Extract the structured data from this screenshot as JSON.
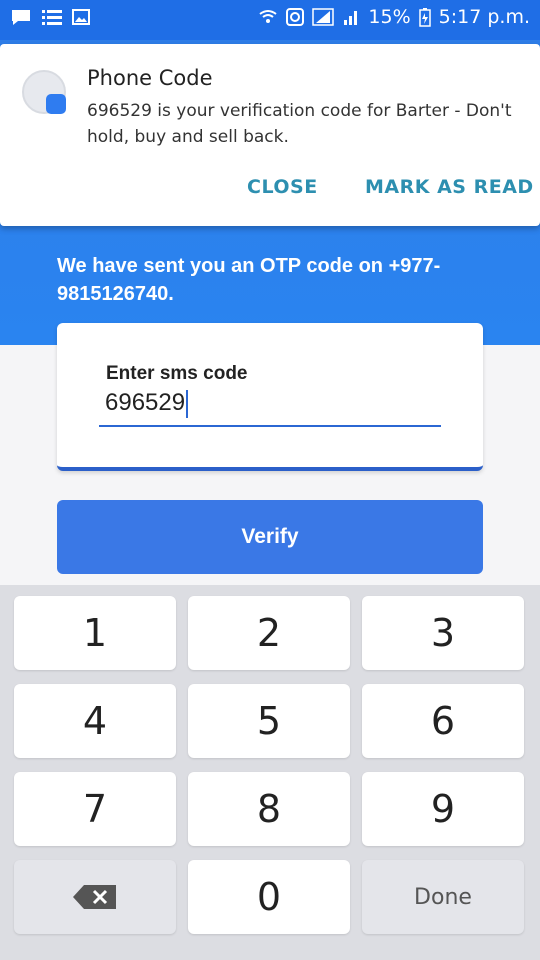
{
  "status_bar": {
    "battery": "15%",
    "time": "5:17 p.m."
  },
  "notification": {
    "title": "Phone Code",
    "body": "696529 is your verification code for Barter - Don't hold, buy and sell back.",
    "actions": [
      "CLOSE",
      "MARK AS READ"
    ]
  },
  "otp_message": "We have sent you an OTP code on +977-9815126740.",
  "sms_card": {
    "label": "Enter sms code",
    "value": "696529"
  },
  "verify_label": "Verify",
  "keypad": {
    "keys": [
      "1",
      "2",
      "3",
      "4",
      "5",
      "6",
      "7",
      "8",
      "9",
      "0"
    ],
    "done_label": "Done",
    "backspace_icon": "backspace-icon"
  },
  "colors": {
    "accent": "#2e7de8",
    "verify_bg": "#3a78e6",
    "notif_action": "#2d8fb0"
  }
}
